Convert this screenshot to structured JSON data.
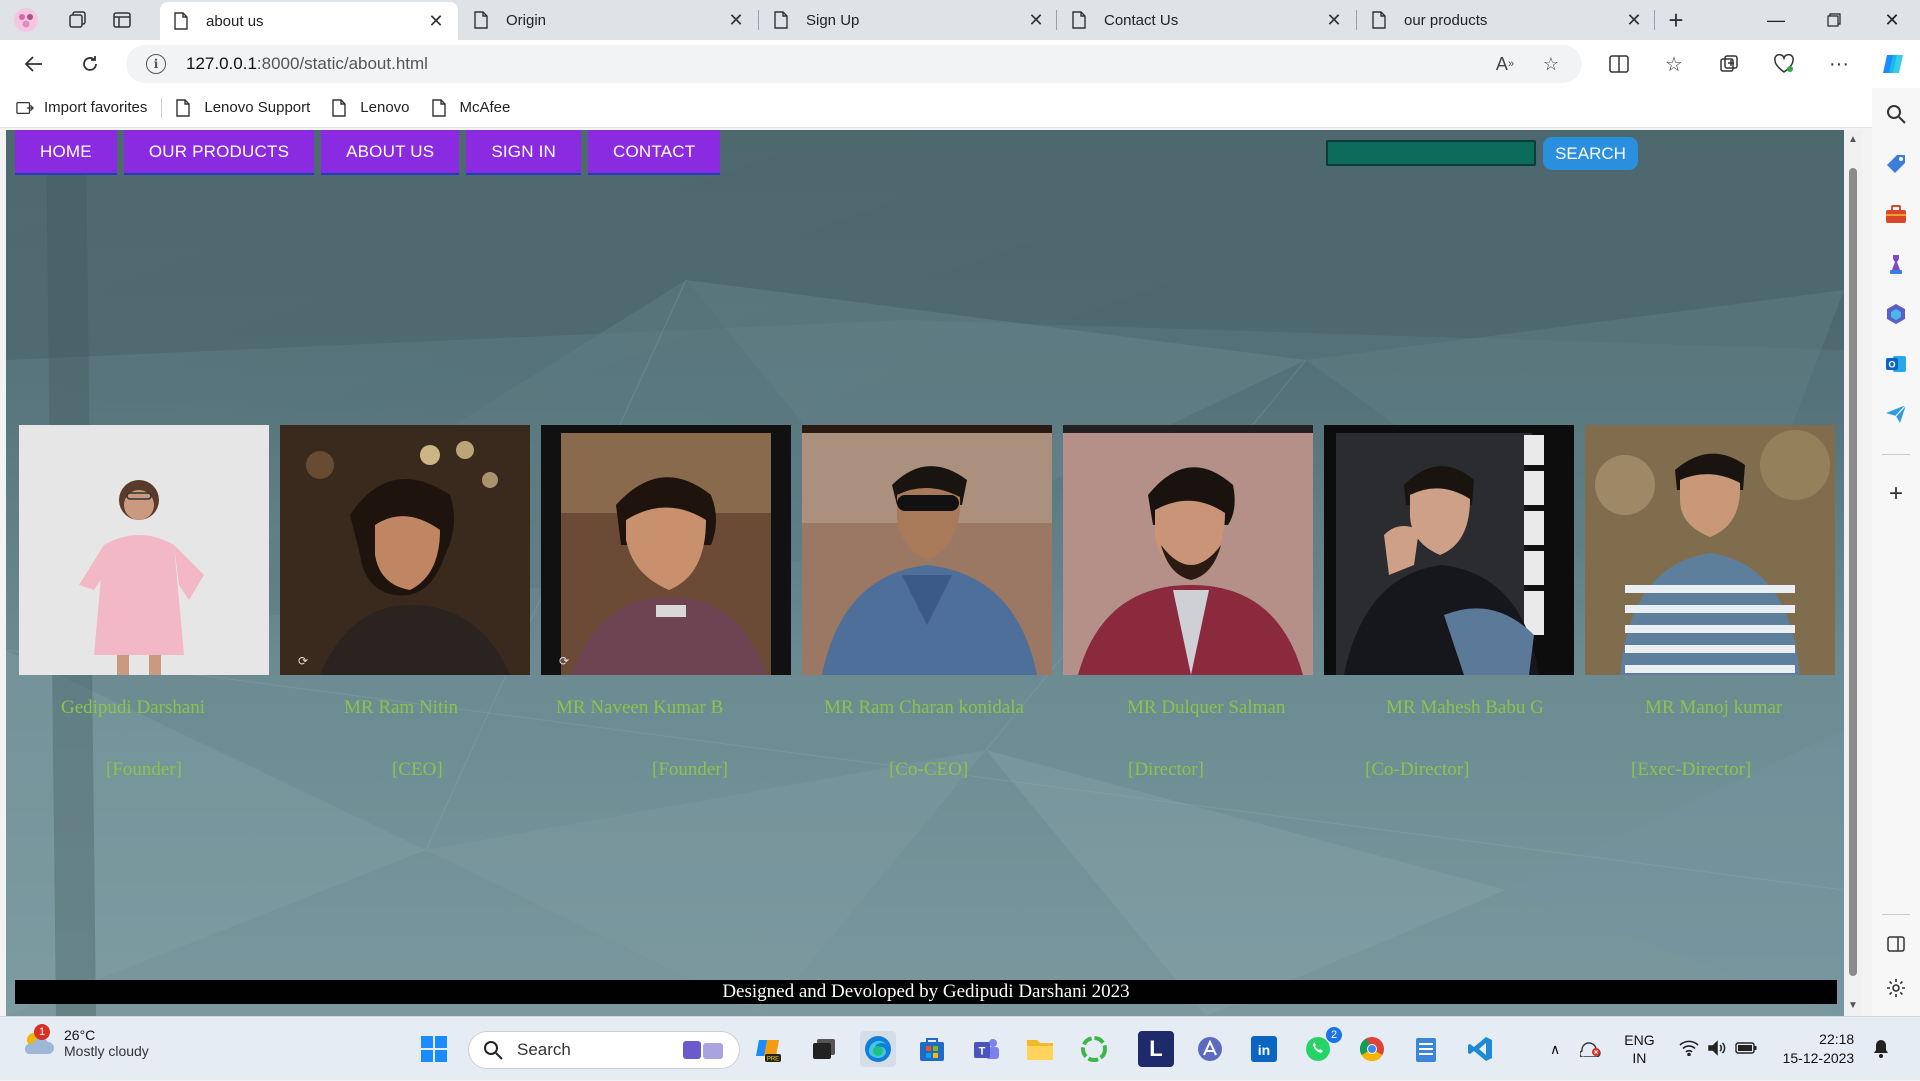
{
  "browser": {
    "tabs": [
      {
        "title": "about us",
        "active": true
      },
      {
        "title": "Origin",
        "active": false
      },
      {
        "title": "Sign Up",
        "active": false
      },
      {
        "title": "Contact Us",
        "active": false
      },
      {
        "title": "our products",
        "active": false
      }
    ],
    "url_host": "127.0.0.1",
    "url_path": ":8000/static/about.html",
    "favorites": [
      {
        "label": "Import favorites",
        "icon": "import-icon"
      },
      {
        "label": "Lenovo Support",
        "icon": "page-icon"
      },
      {
        "label": "Lenovo",
        "icon": "page-icon"
      },
      {
        "label": "McAfee",
        "icon": "page-icon"
      }
    ]
  },
  "site": {
    "nav": [
      "HOME",
      "OUR PRODUCTS",
      "ABOUT US",
      "SIGN IN",
      "CONTACT"
    ],
    "search_button": "SEARCH",
    "search_value": "",
    "team": [
      {
        "name": "Gedipudi Darshani",
        "role": "[Founder]"
      },
      {
        "name": "MR Ram Nitin",
        "role": "[CEO]"
      },
      {
        "name": "MR Naveen Kumar B",
        "role": "[Founder]"
      },
      {
        "name": "MR Ram Charan konidala",
        "role": "[Co-CEO]"
      },
      {
        "name": "MR Dulquer Salman",
        "role": "[Director]"
      },
      {
        "name": "MR Mahesh Babu G",
        "role": "[Co-Director]"
      },
      {
        "name": "MR Manoj kumar",
        "role": "[Exec-Director]"
      }
    ],
    "footer": "Designed and Devoloped by Gedipudi Darshani 2023",
    "colors": {
      "nav_bg": "#8a2be2",
      "text_accent": "#8bc34a",
      "search_btn": "#2b8fe0"
    }
  },
  "taskbar": {
    "weather_temp": "26°C",
    "weather_desc": "Mostly cloudy",
    "weather_badge": "1",
    "search_label": "Search",
    "whatsapp_badge": "2",
    "lang_top": "ENG",
    "lang_bottom": "IN",
    "time": "22:18",
    "date": "15-12-2023"
  }
}
